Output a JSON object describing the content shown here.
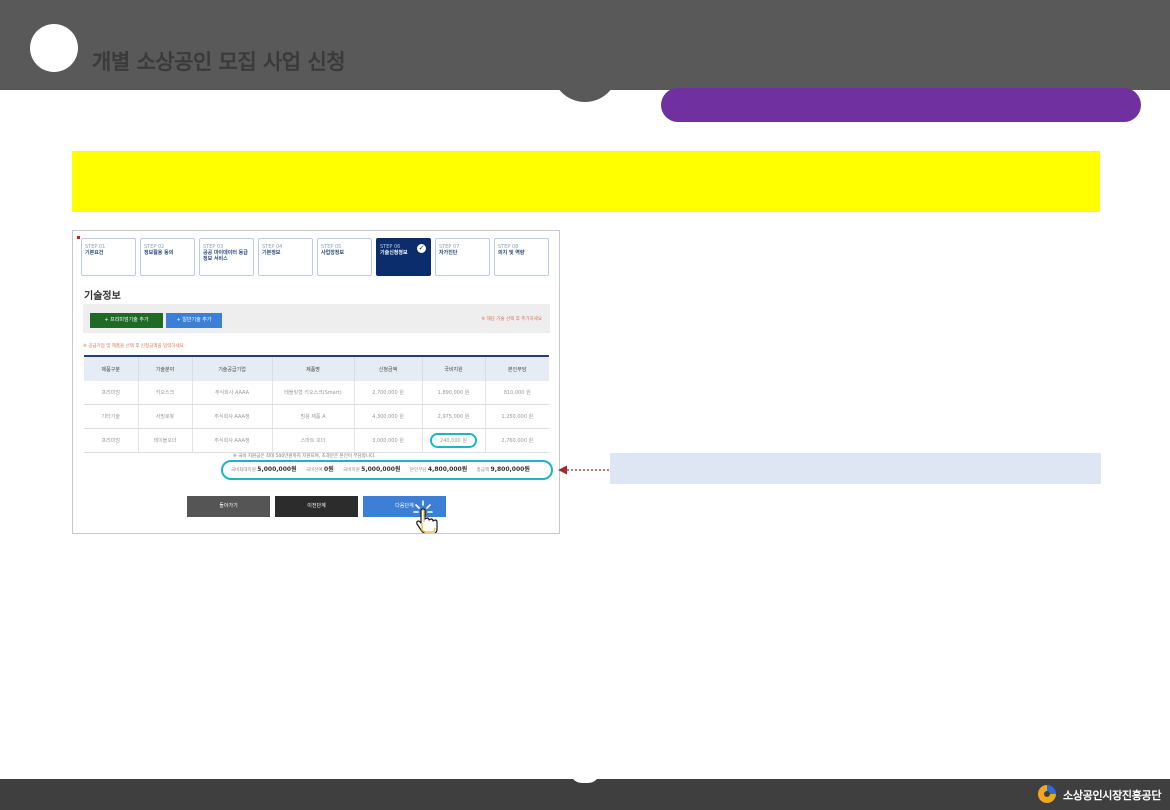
{
  "header": {
    "title": "개별 소상공인 모집 사업 신청"
  },
  "screenshot": {
    "steps": [
      {
        "num": "STEP 01",
        "name": "기본요건"
      },
      {
        "num": "STEP 02",
        "name": "정보활용 동의"
      },
      {
        "num": "STEP 03",
        "name": "공공 마이데이터 등급정보 서비스"
      },
      {
        "num": "STEP 04",
        "name": "기본정보"
      },
      {
        "num": "STEP 05",
        "name": "사업장정보"
      },
      {
        "num": "STEP 06",
        "name": "기술신청정보"
      },
      {
        "num": "STEP 07",
        "name": "자가진단"
      },
      {
        "num": "STEP 08",
        "name": "의지 및 역량"
      }
    ],
    "active_step": 5,
    "section_title": "기술정보",
    "add_premium_label": "+ 프리미엄기술 추가",
    "add_general_label": "+ 일반기술 추가",
    "add_note": "※ 해당 기술 선택 후 추가하세요",
    "red_note": "※ 공급기업 및 제품을 선택 후 신청금액을 입력하세요",
    "table": {
      "headers": [
        "제품구분",
        "기술분야",
        "기술공급기업",
        "제품명",
        "신청금액",
        "국비지원",
        "본인부담"
      ],
      "rows": [
        [
          "프리미엄",
          "키오스크",
          "주식회사 AAAA",
          "테블릿형 키오스크(Smart)",
          "2,700,000 원",
          "1,890,000 원",
          "810,000 원"
        ],
        [
          "기타기술",
          "서빙로봇",
          "주식회사 AAA정",
          "범용 제품 A",
          "4,300,000 원",
          "2,975,000 원",
          "1,250,000 원"
        ],
        [
          "프리미엄",
          "테이블오더",
          "주식회사 AAA정",
          "스마트 오더",
          "3,000,000 원",
          "240,000 원",
          "2,760,000 원"
        ]
      ]
    },
    "sum_note": "※ 국비 지원금은 최대 500만원까지 지원되며, 초과분은 본인이 부담합니다.",
    "summary": [
      {
        "label": "국비최대지원",
        "value": "5,000,000원"
      },
      {
        "label": "국비잔여",
        "value": "0원"
      },
      {
        "label": "국비지원",
        "value": "5,000,000원"
      },
      {
        "label": "본인부담",
        "value": "4,800,000원"
      },
      {
        "label": "총금액",
        "value": "9,800,000원"
      }
    ],
    "buttons": {
      "back": "돌아가기",
      "prev": "이전단계",
      "next": "다음단계"
    }
  },
  "footer": {
    "logo_text": "소상공인시장진흥공단"
  },
  "colors": {
    "header_bg": "#595959",
    "accent_purple": "#7030a0",
    "highlight_yellow": "#ffff00",
    "callout_bg": "#dde6f2",
    "oval_cyan": "#1cb4c6"
  }
}
